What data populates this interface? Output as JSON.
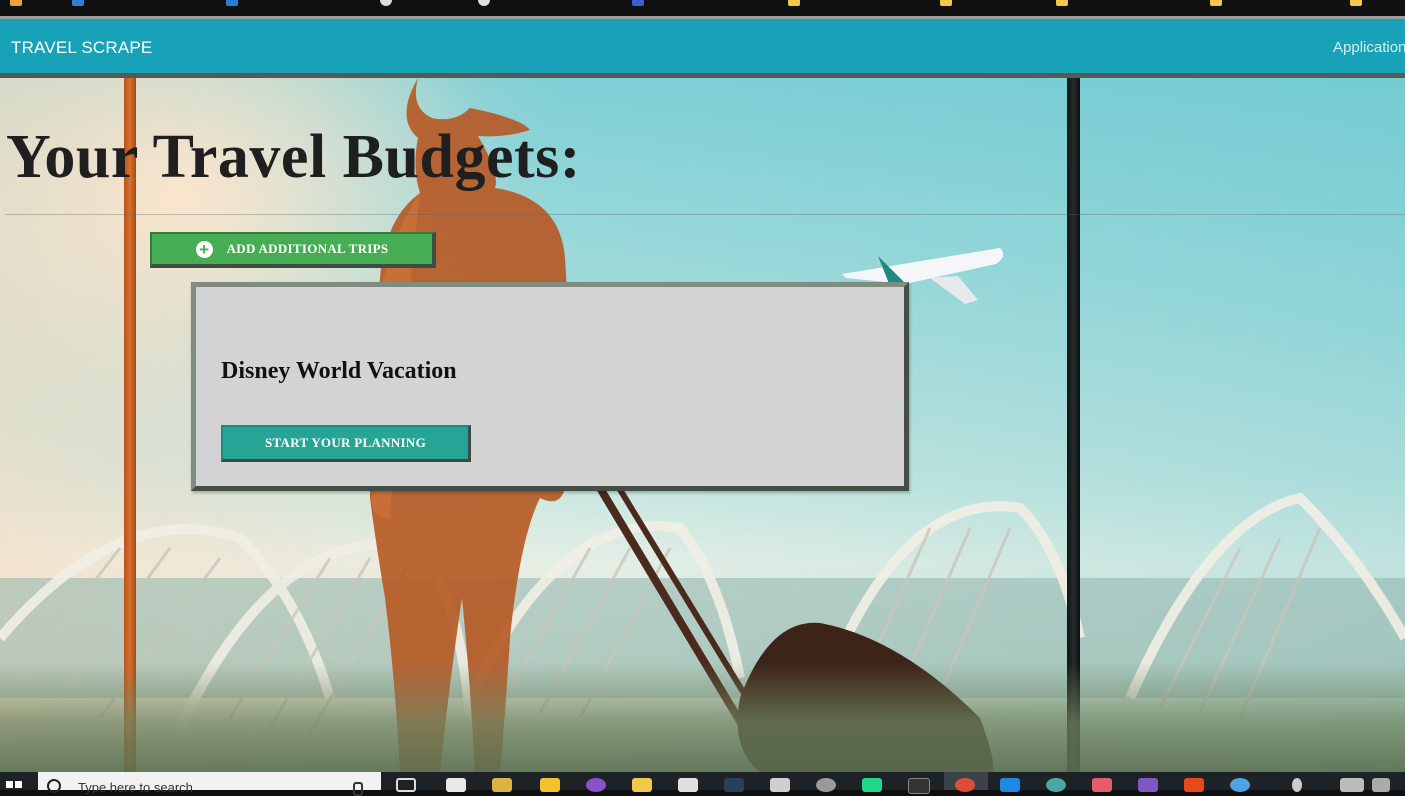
{
  "navbar": {
    "brand": "TRAVEL SCRAPE",
    "link": "Application",
    "color": "#17a2b8"
  },
  "page": {
    "title": "Your Travel Budgets:"
  },
  "actions": {
    "add_trips_label": "ADD ADDITIONAL TRIPS",
    "add_icon": "plus-circle-icon"
  },
  "trips": [
    {
      "name": "Disney World Vacation",
      "button_label": "START YOUR PLANNING"
    }
  ],
  "taskbar": {
    "search_placeholder": "Type here to search",
    "icons": [
      "windows-start-icon",
      "task-view-icon",
      "calculator-icon",
      "file-explorer-icon",
      "store-icon",
      "teams-icon",
      "folder-icon",
      "notepad-icon",
      "terminal-icon",
      "file-icon",
      "database-icon",
      "pycharm-icon",
      "cmd-icon",
      "chrome-icon",
      "vscode-icon",
      "app-icon",
      "paint-icon",
      "visual-studio-icon",
      "office-icon",
      "globe-icon"
    ]
  }
}
